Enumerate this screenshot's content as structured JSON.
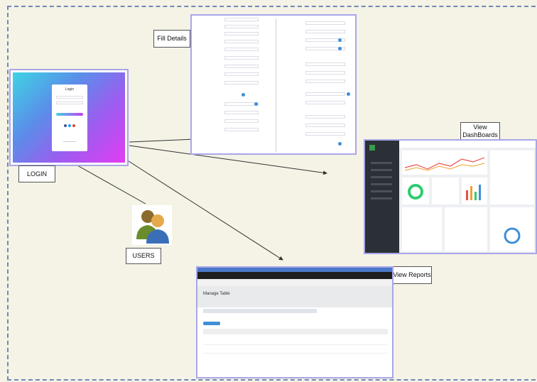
{
  "labels": {
    "login": "LOGIN",
    "fill_details": "Fill Details",
    "view_dashboards": "View\nDashBoards",
    "view_reports": "View Reports",
    "users": "USERS"
  },
  "login_screen": {
    "title": "Login"
  },
  "report_screen": {
    "header_title": "Manage Table"
  },
  "colors": {
    "background": "#f4f3e6",
    "dash_border": "#6f88b8",
    "thumb_border": "#a9a6e8",
    "dashboard_sidebar": "#2b3036",
    "login_gradient_start": "#3fd3e3",
    "login_gradient_end": "#e23cf2"
  }
}
